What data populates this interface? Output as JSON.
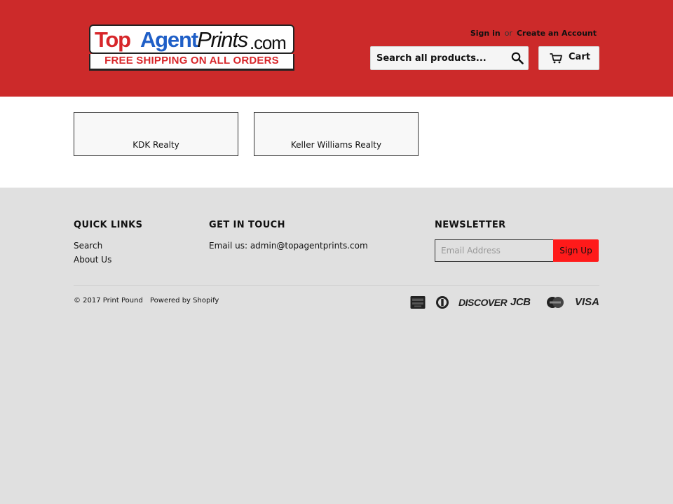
{
  "header": {
    "logo": {
      "word1": "Top",
      "word2": "Agent",
      "word3": "Prints",
      "word4": ".com",
      "tagline": "FREE SHIPPING ON ALL ORDERS"
    },
    "sign_in": "Sign in",
    "or": "or",
    "create_account": "Create an Account",
    "search": {
      "placeholder": "Search all products...",
      "icon": "search-icon"
    },
    "cart": {
      "label": "Cart",
      "icon": "cart-icon"
    },
    "colors": {
      "background": "#cc2a2a"
    }
  },
  "collections": [
    {
      "title": "KDK Realty"
    },
    {
      "title": "Keller Williams Realty"
    }
  ],
  "footer": {
    "quick_links": {
      "title": "QUICK LINKS",
      "items": [
        "Search",
        "About Us"
      ]
    },
    "get_in_touch": {
      "title": "GET IN TOUCH",
      "text": "Email us: admin@topagentprints.com"
    },
    "newsletter": {
      "title": "NEWSLETTER",
      "placeholder": "Email Address",
      "button": "Sign Up",
      "button_color": "#ff1a1a"
    },
    "copyright": "© 2017 Print Pound",
    "powered_by": "Powered by Shopify",
    "payment_icons": [
      {
        "name": "american-express-icon"
      },
      {
        "name": "diners-club-icon"
      },
      {
        "name": "discover-icon",
        "text": "DISCOVER"
      },
      {
        "name": "jcb-icon",
        "text": "JCB"
      },
      {
        "name": "mastercard-icon"
      },
      {
        "name": "visa-icon",
        "text": "VISA"
      }
    ]
  }
}
